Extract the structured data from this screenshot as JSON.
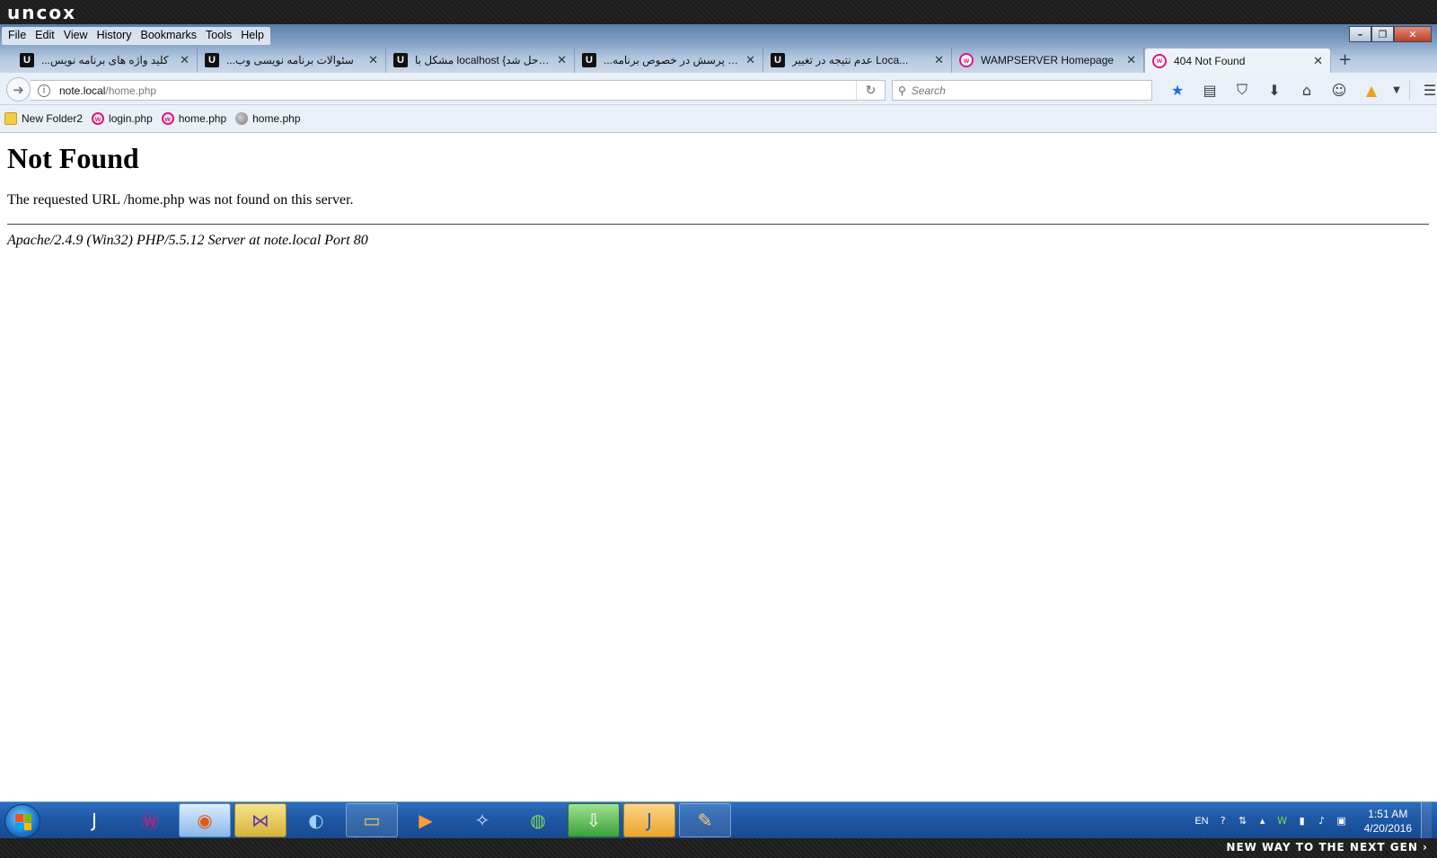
{
  "brand": {
    "logo": "uncox",
    "slogan": "NEW WAY TO THE NEXT GEN ›"
  },
  "menubar": [
    "File",
    "Edit",
    "View",
    "History",
    "Bookmarks",
    "Tools",
    "Help"
  ],
  "tabs": [
    {
      "title": "...کلید واژه های برنامه نویس",
      "icon": "U",
      "active": false
    },
    {
      "title": "...سئوالات برنامه نویسی وب",
      "icon": "U",
      "active": false
    },
    {
      "title": "مشکل با localhost {حل شد} - ...",
      "icon": "U",
      "active": false
    },
    {
      "title": "...طرح پرسش در خصوص برنامه",
      "icon": "U",
      "active": false
    },
    {
      "title": "عدم نتیجه در تغییر Loca...",
      "icon": "U",
      "active": false
    },
    {
      "title": "WAMPSERVER Homepage",
      "icon": "w",
      "active": false
    },
    {
      "title": "404 Not Found",
      "icon": "w",
      "active": true
    }
  ],
  "newtab_label": "+",
  "urlbar": {
    "host": "note.local",
    "path": "/home.php"
  },
  "search": {
    "placeholder": "Search"
  },
  "bookmarks": [
    {
      "label": "New Folder2",
      "icon": "folder-icon"
    },
    {
      "label": "login.php",
      "icon": "wamp-icon"
    },
    {
      "label": "home.php",
      "icon": "wamp-icon"
    },
    {
      "label": "home.php",
      "icon": "globe-icon"
    }
  ],
  "page": {
    "heading": "Not Found",
    "message": "The requested URL /home.php was not found on this server.",
    "address": "Apache/2.4.9 (Win32) PHP/5.5.12 Server at note.local Port 80"
  },
  "tray": {
    "language": "EN",
    "time": "1:51 AM",
    "date": "4/20/2016"
  },
  "colors": {
    "accent": "#1a73d1",
    "wamp": "#e0147d",
    "taskbar": "#1f5aa8"
  }
}
